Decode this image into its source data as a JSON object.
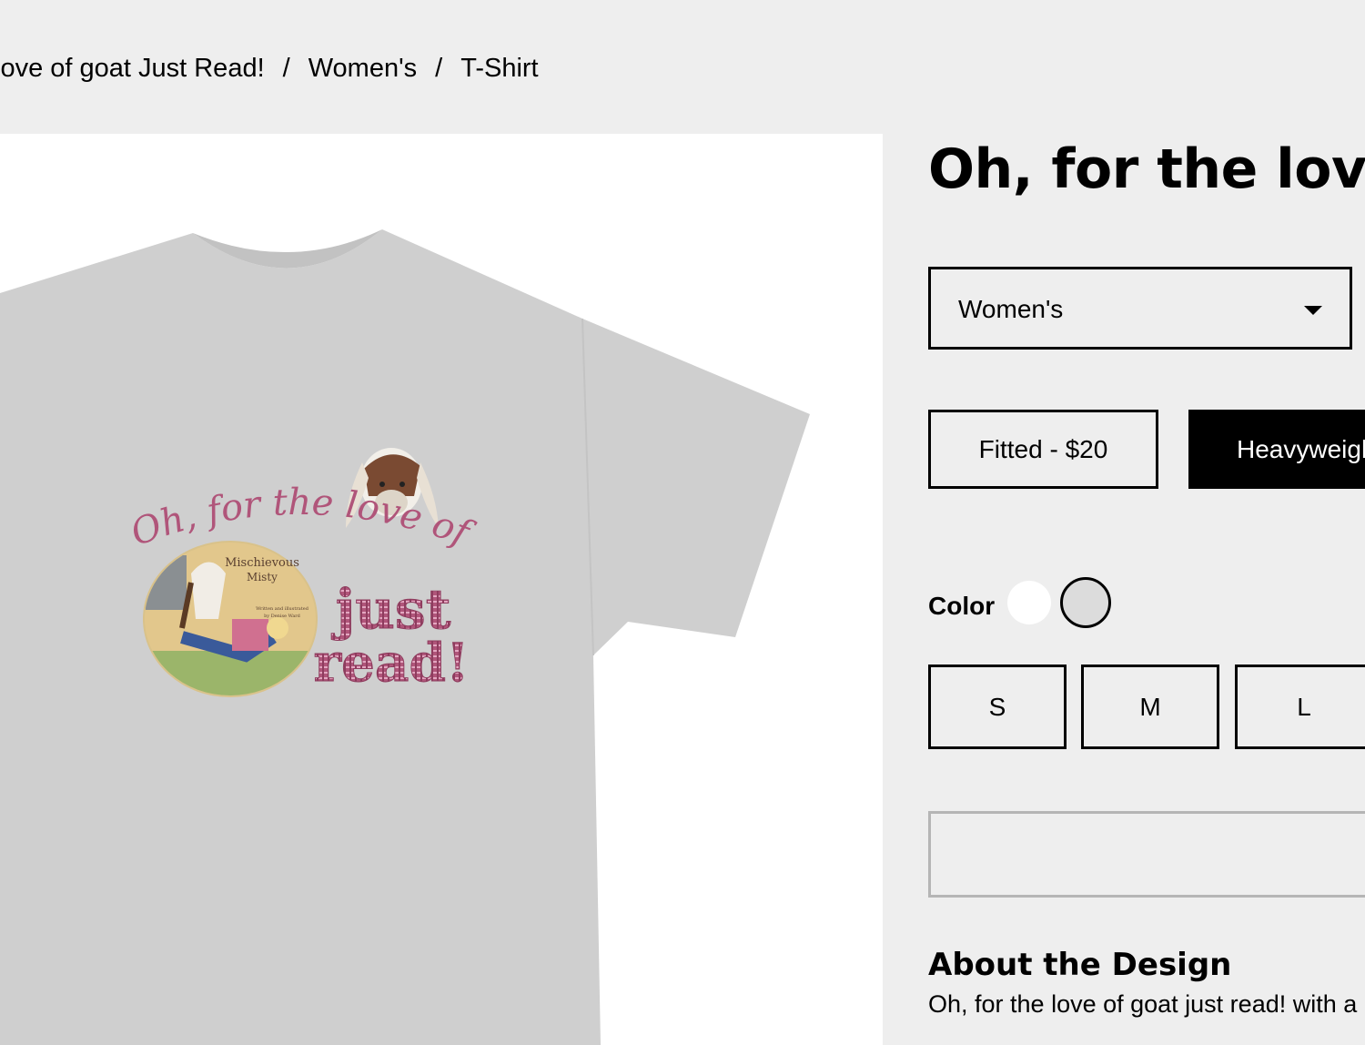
{
  "breadcrumb": {
    "items": [
      "love of goat Just Read!",
      "Women's",
      "T-Shirt"
    ],
    "separator": "/"
  },
  "product": {
    "title": "Oh, for the love of goat Just Read!",
    "design_art": {
      "line1": "Oh, for the love of goat",
      "line2": "just",
      "line3": "read!",
      "book_title_1": "Mischievous",
      "book_title_2": "Misty",
      "book_byline_1": "Written and illustrated",
      "book_byline_2": "by Denise Ward"
    }
  },
  "style_select": {
    "value": "Women's"
  },
  "fits": [
    {
      "label": "Fitted - $20",
      "selected": false
    },
    {
      "label": "Heavyweight",
      "selected": true
    }
  ],
  "color": {
    "label": "Color",
    "swatches": [
      {
        "name": "white",
        "hex": "#ffffff",
        "selected": false
      },
      {
        "name": "heather-gray",
        "hex": "#dcdcdc",
        "selected": true
      }
    ]
  },
  "sizes": [
    "S",
    "M",
    "L"
  ],
  "about": {
    "title": "About the Design",
    "text": "Oh, for the love of goat just read! with a"
  },
  "colors": {
    "page_bg": "#eeeeee",
    "shirt": "#cfcfcf",
    "design_pink": "#b0557a",
    "selected_btn": "#000000"
  }
}
